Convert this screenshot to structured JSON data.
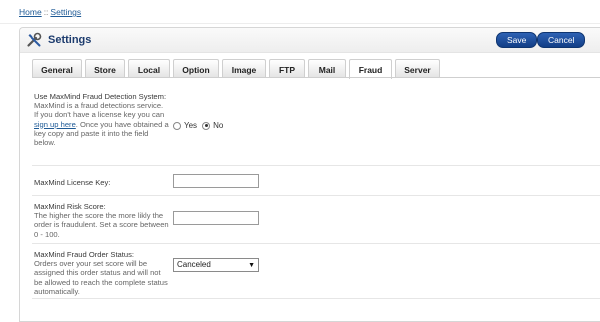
{
  "breadcrumb": {
    "home": "Home",
    "separator": "::",
    "current": "Settings"
  },
  "header": {
    "title": "Settings",
    "icon": "tools-icon",
    "save_label": "Save",
    "cancel_label": "Cancel"
  },
  "tabs": [
    {
      "label": "General",
      "width": 50
    },
    {
      "label": "Store",
      "width": 40
    },
    {
      "label": "Local",
      "width": 42
    },
    {
      "label": "Option",
      "width": 46
    },
    {
      "label": "Image",
      "width": 44
    },
    {
      "label": "FTP",
      "width": 36
    },
    {
      "label": "Mail",
      "width": 38
    },
    {
      "label": "Fraud",
      "width": 43,
      "active": true
    },
    {
      "label": "Server",
      "width": 45
    }
  ],
  "form": {
    "fraud_detection": {
      "title": "Use MaxMind Fraud Detection System:",
      "help_before": "MaxMind is a fraud detections service. If you don't have a license key you can ",
      "help_link": "sign up here",
      "help_after": ". Once you have obtained a key copy and paste it into the field below.",
      "yes_label": "Yes",
      "no_label": "No",
      "selected": "No"
    },
    "license_key": {
      "title": "MaxMind License Key:",
      "value": ""
    },
    "risk_score": {
      "title": "MaxMind Risk Score:",
      "help": "The higher the score the more likly the order is fraudulent. Set a score between 0 - 100.",
      "value": ""
    },
    "order_status": {
      "title": "MaxMind Fraud Order Status:",
      "help": "Orders over your set score will be assigned this order status and will not be allowed to reach the complete status automatically.",
      "selected": "Canceled"
    }
  }
}
